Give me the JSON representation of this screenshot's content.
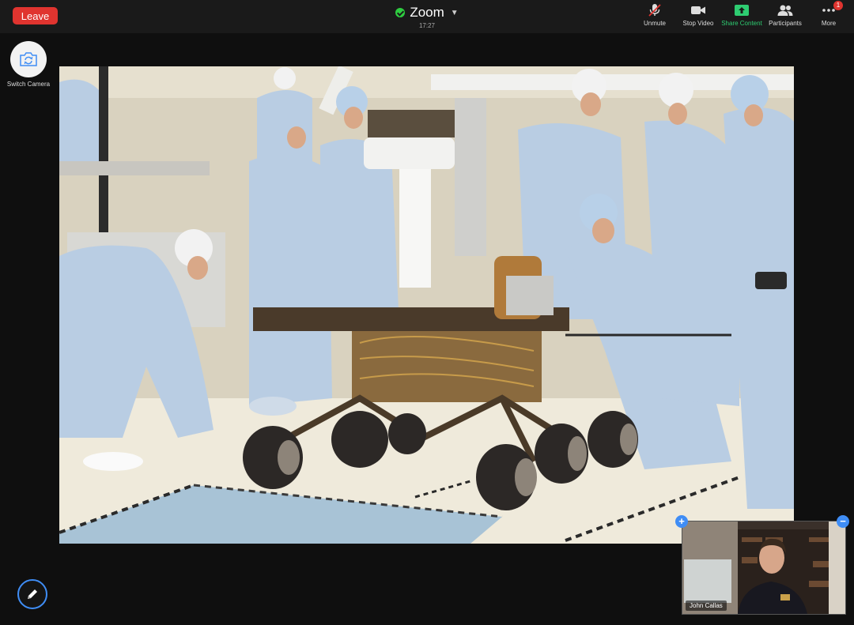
{
  "toolbar": {
    "leave_label": "Leave",
    "app_title": "Zoom",
    "elapsed_time": "17:27",
    "unmute_label": "Unmute",
    "stop_video_label": "Stop Video",
    "share_content_label": "Share Content",
    "participants_label": "Participants",
    "more_label": "More",
    "more_badge": "1"
  },
  "side": {
    "switch_camera_label": "Switch Camera"
  },
  "self_view": {
    "name": "John Callas"
  },
  "icons": {
    "leave": "leave-button",
    "security": "shield-check-icon",
    "unmute": "muted-mic-icon",
    "stop_video": "video-camera-icon",
    "share": "share-up-arrow-icon",
    "participants": "people-icon",
    "more": "ellipsis-icon",
    "switch_camera": "camera-rotate-icon",
    "annotate": "pencil-icon"
  },
  "colors": {
    "leave_red": "#e0342f",
    "share_green": "#2ecc71",
    "accent_blue": "#3f8df5",
    "topbar": "#1a1a1a"
  }
}
